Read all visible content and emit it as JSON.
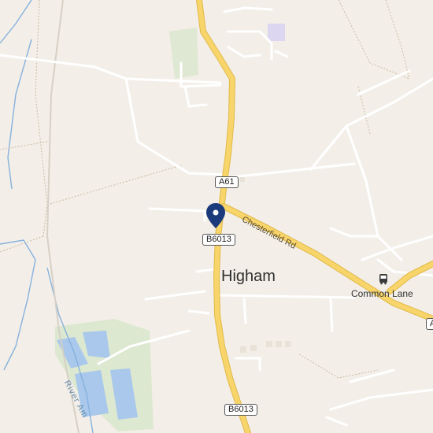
{
  "map": {
    "place_name": "Higham",
    "poi_label": "Common Lane",
    "roads": {
      "a61_shield": "A61",
      "b6013_shield_top": "B6013",
      "b6013_shield_bottom": "B6013",
      "a_shield_partial": "A",
      "chesterfield_rd": "Chesterfield Rd"
    },
    "river_label": "River Am",
    "icons": {
      "pin": "location-pin-icon",
      "bus": "bus-stop-icon"
    },
    "colors": {
      "background": "#f3efe8",
      "major_road": "#f7d56b",
      "major_road_edge": "#e2b94a",
      "minor_road": "#ffffff",
      "water": "#a9c8ec",
      "green": "#dde8d0",
      "pin": "#1a3a7c"
    }
  }
}
